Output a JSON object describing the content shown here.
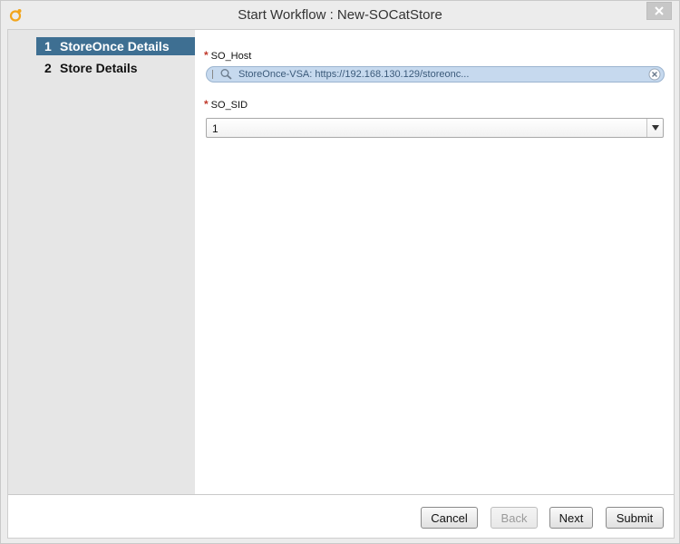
{
  "window": {
    "title": "Start Workflow : New-SOCatStore"
  },
  "sidebar": {
    "steps": [
      {
        "number": "1",
        "label": "StoreOnce Details",
        "active": true
      },
      {
        "number": "2",
        "label": "Store Details",
        "active": false
      }
    ]
  },
  "form": {
    "required_marker": "*",
    "so_host": {
      "label": "SO_Host",
      "value": "StoreOnce-VSA: https://192.168.130.129/storeonc..."
    },
    "so_sid": {
      "label": "SO_SID",
      "selected": "1"
    }
  },
  "footer": {
    "cancel_label": "Cancel",
    "back_label": "Back",
    "next_label": "Next",
    "submit_label": "Submit"
  },
  "colors": {
    "accent": "#3e6f92",
    "required": "#c0392b",
    "host_field_bg": "#c6d9ee"
  }
}
